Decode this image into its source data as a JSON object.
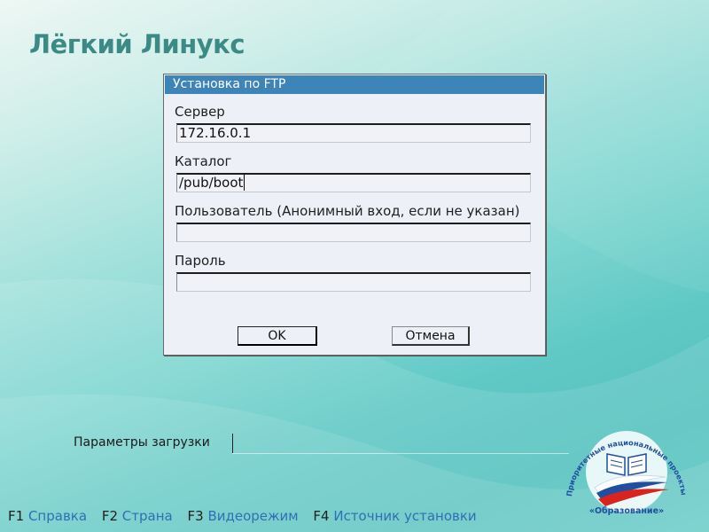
{
  "app": {
    "title": "Лёгкий Линукс"
  },
  "dialog": {
    "title": "Установка по FTP",
    "fields": [
      {
        "label": "Сервер",
        "value": "172.16.0.1"
      },
      {
        "label": "Каталог",
        "value": "/pub/boot"
      },
      {
        "label": "Пользователь (Анонимный вход, если не указан)",
        "value": ""
      },
      {
        "label": "Пароль",
        "value": ""
      }
    ],
    "ok_label": "OK",
    "cancel_label": "Отмена"
  },
  "boot": {
    "label": "Параметры загрузки",
    "value": ""
  },
  "fkeys": [
    {
      "key": "F1",
      "label": "Справка"
    },
    {
      "key": "F2",
      "label": "Страна"
    },
    {
      "key": "F3",
      "label": "Видеорежим"
    },
    {
      "key": "F4",
      "label": "Источник установки"
    }
  ],
  "logo": {
    "arc_text": "Приоритетные национальные проекты",
    "bottom_text": "«Образование»"
  },
  "colors": {
    "title_text": "#3b8a86",
    "dialog_titlebar": "#3d84b8",
    "dialog_bg": "#eef0f7",
    "fkey_label": "#2f6fb5"
  }
}
